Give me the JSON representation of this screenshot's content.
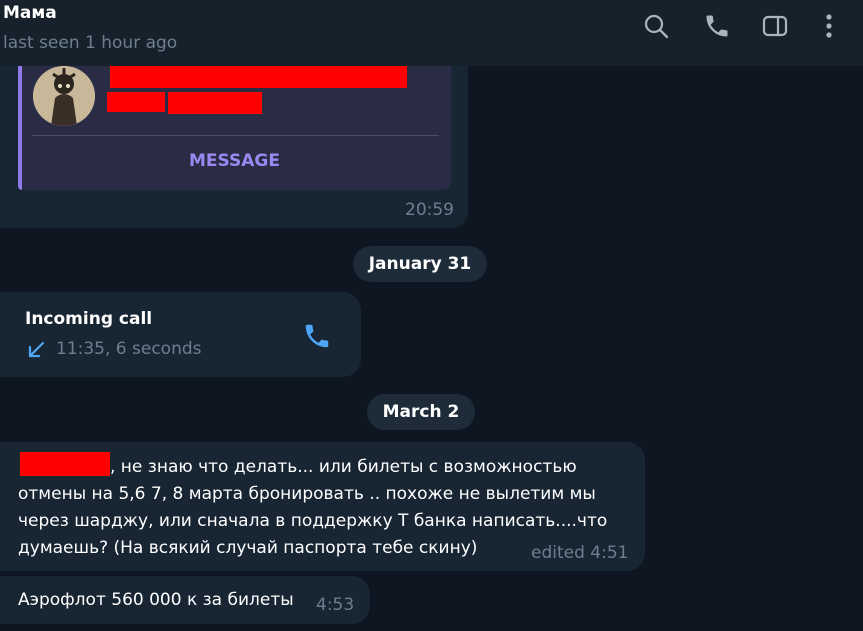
{
  "header": {
    "contact_name": "Мама",
    "status": "last seen 1 hour ago",
    "icons": [
      "search-icon",
      "phone-icon",
      "sidebar-panel-icon",
      "more-vertical-icon"
    ]
  },
  "shared_contact": {
    "button_label": "MESSAGE",
    "time": "20:59"
  },
  "dates": {
    "first": "January 31",
    "second": "March 2"
  },
  "call": {
    "title": "Incoming call",
    "detail": "11:35, 6 seconds",
    "icons": [
      "incoming-arrow-icon",
      "phone-icon"
    ]
  },
  "messages": [
    {
      "lines": [
        ", не знаю что делать... или билеты с возможностью",
        "отмены на 5,6 7, 8 марта бронировать .. похоже не вылетим мы",
        "через шарджу, или сначала в поддержку Т банка написать....что",
        "думаешь? (На всякий случай паспорта тебе скину)"
      ],
      "meta": "edited 4:51"
    },
    {
      "text": "Аэрофлот 560 000 к за билеты",
      "meta": "4:53"
    }
  ],
  "colors": {
    "background": "#0e1621",
    "header": "#17212b",
    "bubble": "#182533",
    "accent_purple": "#8f7ae8",
    "call_icon_blue": "#4ea4f6",
    "muted_text": "#6d7f8f",
    "redaction": "#ff0000"
  }
}
